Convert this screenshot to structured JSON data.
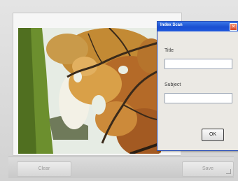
{
  "dialog": {
    "title": "Index Scan",
    "title_field_label": "Title",
    "title_field_value": "",
    "subject_field_label": "Subject",
    "subject_field_value": "",
    "ok_label": "OK",
    "close_icon": "close-icon"
  },
  "toolbar": {
    "clear_label": "Clear",
    "save_label": "Save"
  },
  "colors": {
    "titlebar": "#1a4fd0",
    "close_button": "#d84a2a",
    "window_background": "#d9d9d9"
  }
}
